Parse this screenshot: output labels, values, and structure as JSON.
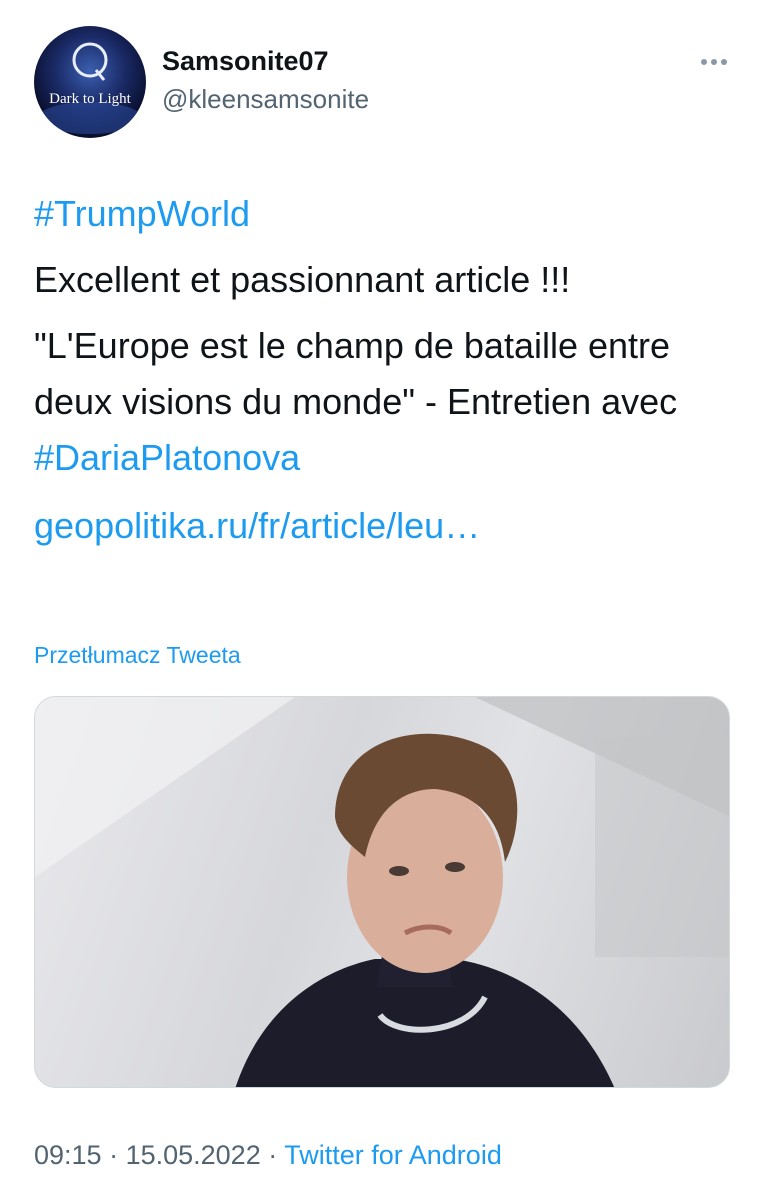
{
  "author": {
    "display_name": "Samsonite07",
    "handle": "@kleensamsonite",
    "avatar_text": "Dark to Light",
    "avatar_letter": "Q"
  },
  "tweet": {
    "hashtag": "#TrumpWorld",
    "line1": "Excellent et passionnant article !!!",
    "quote_part1": "\"L'Europe est le champ de bataille entre deux visions du monde\" - Entretien avec ",
    "quote_hashtag": "#DariaPlatonova",
    "link": "geopolitika.ru/fr/article/leu…"
  },
  "translate_label": "Przetłumacz Tweeta",
  "meta": {
    "time": "09:15",
    "sep1": " · ",
    "date": "15.05.2022",
    "sep2": " · ",
    "source": "Twitter for Android"
  },
  "icons": {
    "more": "more-icon"
  },
  "colors": {
    "link": "#1d9bf0",
    "secondary": "#536471",
    "text": "#0f1419"
  }
}
